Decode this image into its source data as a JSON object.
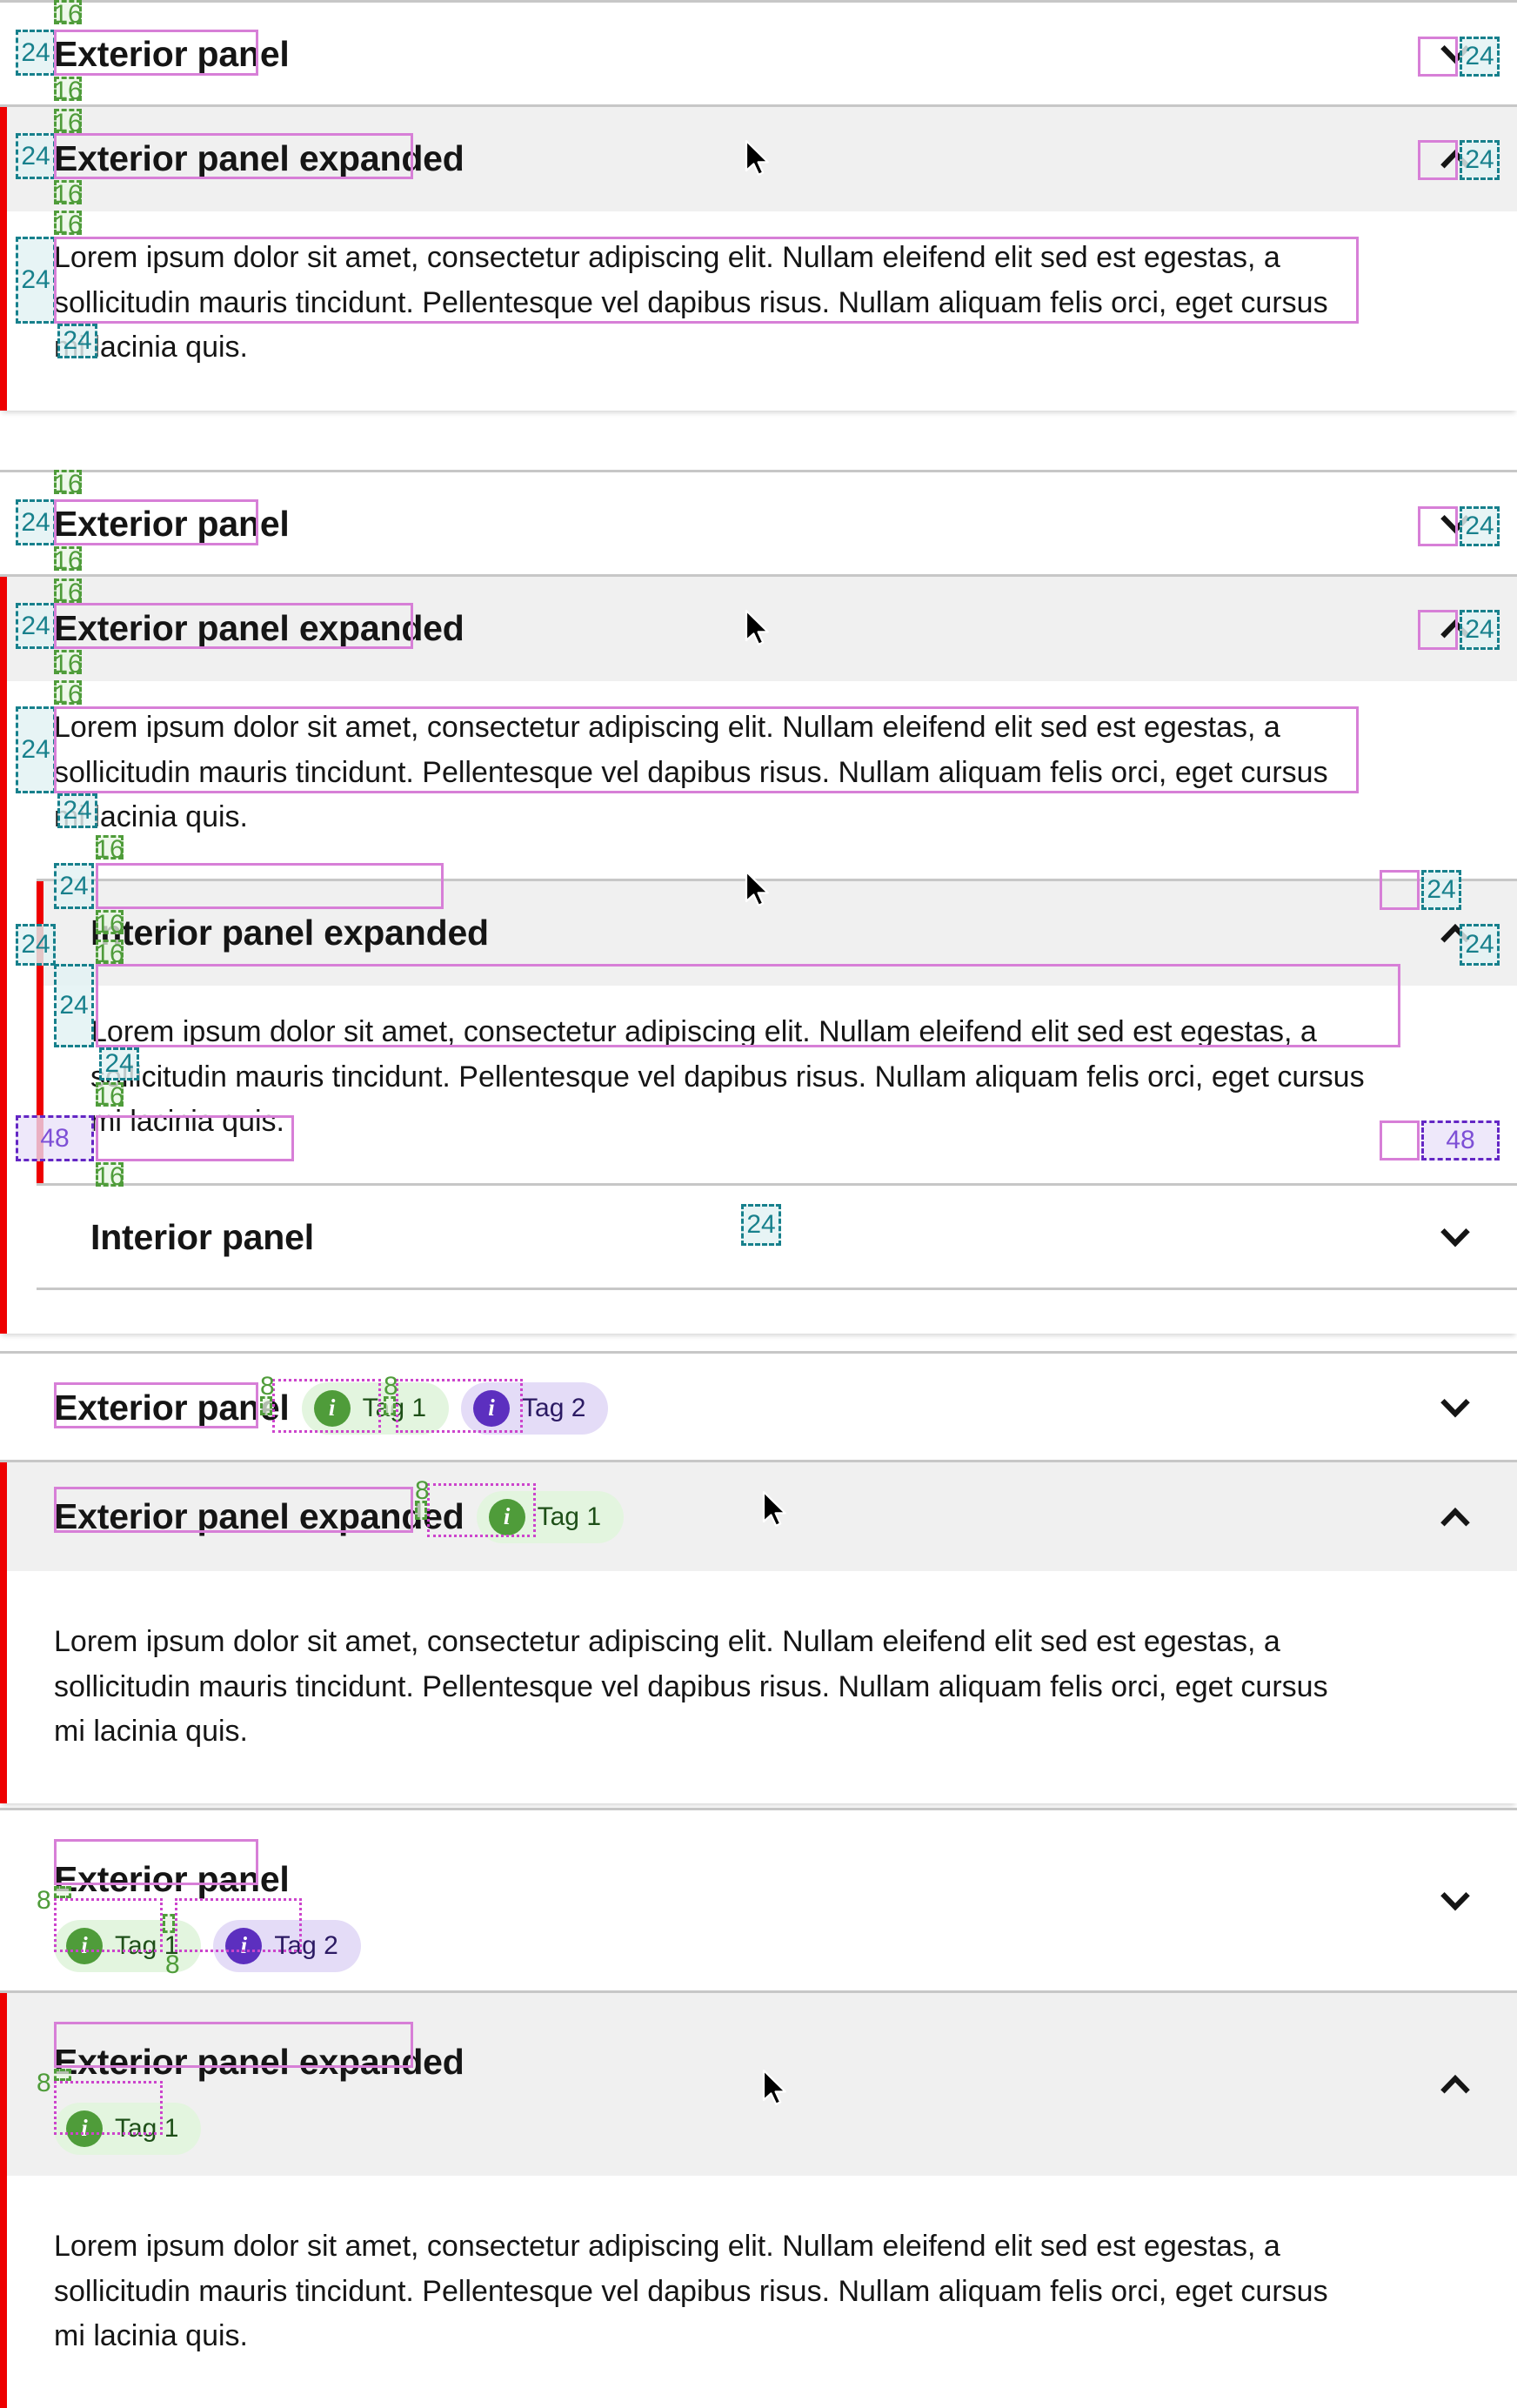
{
  "meta": {
    "doc_kind": "design-spec-redline",
    "colors": {
      "accent_red": "#ee0000",
      "header_bg": "#f0f0f0",
      "border_gray": "#c7c7c7",
      "measure_pink": "#d77fd7",
      "spacing_teal": "#17808c",
      "spacing_green": "#4f9c3a",
      "spacing_purple": "#6326c4",
      "tag_green_bg": "#e3f5df",
      "tag_green_icon": "#4f9c3a",
      "tag_purple_bg": "#e4dcf7",
      "tag_purple_icon": "#5c2fbf"
    }
  },
  "strings": {
    "exterior_panel": "Exterior panel",
    "exterior_panel_expanded": "Exterior panel expanded",
    "interior_panel": "Interior panel",
    "interior_panel_expanded": "Interior panel expanded",
    "body_text": "Lorem ipsum dolor sit amet, consectetur adipiscing elit. Nullam eleifend elit sed est egestas, a sollicitudin mauris tincidunt. Pellentesque vel dapibus risus. Nullam aliquam felis orci, eget cursus mi lacinia quis.",
    "tag1": "Tag 1",
    "tag2": "Tag 2",
    "info_glyph": "i",
    "chevron_down": "chevron-down-icon",
    "chevron_up": "chevron-up-icon"
  },
  "spacing_values": {
    "s8": "8",
    "s16": "16",
    "s24": "24",
    "s48": "48"
  },
  "sections": [
    {
      "id": "section-1",
      "name": "exterior-panel-basic",
      "panels": [
        {
          "title": "Exterior panel",
          "state": "collapsed",
          "chevron": "chevron-down-icon"
        },
        {
          "title": "Exterior panel expanded",
          "state": "expanded",
          "chevron": "chevron-up-icon",
          "body": "Lorem ipsum dolor sit amet, consectetur adipiscing elit. Nullam eleifend elit sed est egestas, a sollicitudin mauris tincidunt. Pellentesque vel dapibus risus. Nullam aliquam felis orci, eget cursus mi lacinia quis."
        }
      ],
      "annotations": [
        "16",
        "24",
        "16",
        "16",
        "24",
        "16",
        "16",
        "24",
        "24",
        "24",
        "24"
      ]
    },
    {
      "id": "section-2",
      "name": "nested-interior-panels",
      "panels": [
        {
          "title": "Exterior panel",
          "state": "collapsed",
          "chevron": "chevron-down-icon"
        },
        {
          "title": "Exterior panel expanded",
          "state": "expanded",
          "chevron": "chevron-up-icon",
          "body": "Lorem ipsum dolor sit amet, consectetur adipiscing elit. Nullam eleifend elit sed est egestas, a sollicitudin mauris tincidunt. Pellentesque vel dapibus risus. Nullam aliquam felis orci, eget cursus mi lacinia quis.",
          "children": [
            {
              "title": "Interior panel expanded",
              "state": "expanded",
              "chevron": "chevron-up-icon",
              "body": "Lorem ipsum dolor sit amet, consectetur adipiscing elit. Nullam eleifend elit sed est egestas, a sollicitudin mauris tincidunt. Pellentesque vel dapibus risus. Nullam aliquam felis orci, eget cursus mi lacinia quis."
            },
            {
              "title": "Interior panel",
              "state": "collapsed",
              "chevron": "chevron-down-icon"
            }
          ]
        }
      ],
      "annotations": [
        "16",
        "24",
        "16",
        "16",
        "24",
        "16",
        "16",
        "24",
        "24",
        "16",
        "24",
        "16",
        "16",
        "24",
        "24",
        "24",
        "16",
        "48",
        "48",
        "16",
        "24"
      ]
    },
    {
      "id": "section-3",
      "name": "panels-with-inline-tags",
      "panels": [
        {
          "title": "Exterior panel",
          "state": "collapsed",
          "chevron": "chevron-down-icon",
          "tags": [
            {
              "label": "Tag 1",
              "variant": "green"
            },
            {
              "label": "Tag 2",
              "variant": "purple"
            }
          ],
          "tag_layout": "inline"
        },
        {
          "title": "Exterior panel expanded",
          "state": "expanded",
          "chevron": "chevron-up-icon",
          "tags": [
            {
              "label": "Tag 1",
              "variant": "green"
            }
          ],
          "tag_layout": "inline",
          "body": "Lorem ipsum dolor sit amet, consectetur adipiscing elit. Nullam eleifend elit sed est egestas, a sollicitudin mauris tincidunt. Pellentesque vel dapibus risus. Nullam aliquam felis orci, eget cursus mi lacinia quis."
        }
      ],
      "annotations": [
        "8",
        "8",
        "8"
      ]
    },
    {
      "id": "section-4",
      "name": "panels-with-stacked-tags",
      "panels": [
        {
          "title": "Exterior panel",
          "state": "collapsed",
          "chevron": "chevron-down-icon",
          "tags": [
            {
              "label": "Tag 1",
              "variant": "green"
            },
            {
              "label": "Tag 2",
              "variant": "purple"
            }
          ],
          "tag_layout": "stacked"
        },
        {
          "title": "Exterior panel expanded",
          "state": "expanded",
          "chevron": "chevron-up-icon",
          "tags": [
            {
              "label": "Tag 1",
              "variant": "green"
            }
          ],
          "tag_layout": "stacked",
          "body": "Lorem ipsum dolor sit amet, consectetur adipiscing elit. Nullam eleifend elit sed est egestas, a sollicitudin mauris tincidunt. Pellentesque vel dapibus risus. Nullam aliquam felis orci, eget cursus mi lacinia quis."
        }
      ],
      "annotations": [
        "8",
        "8",
        "8"
      ]
    }
  ]
}
